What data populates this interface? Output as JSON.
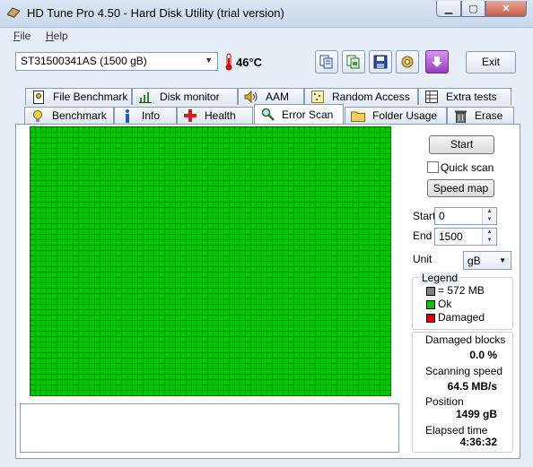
{
  "window": {
    "title": "HD Tune Pro 4.50 - Hard Disk Utility (trial version)"
  },
  "menu": {
    "file": "File",
    "help": "Help"
  },
  "toolbar": {
    "drive": "ST31500341AS (1500 gB)",
    "temperature": "46°C",
    "exit_label": "Exit"
  },
  "tabs_row1": [
    {
      "label": "File Benchmark",
      "icon": "file-icon"
    },
    {
      "label": "Disk monitor",
      "icon": "chart-icon"
    },
    {
      "label": "AAM",
      "icon": "speaker-icon"
    },
    {
      "label": "Random Access",
      "icon": "grid-icon"
    },
    {
      "label": "Extra tests",
      "icon": "table-icon"
    }
  ],
  "tabs_row2": [
    {
      "label": "Benchmark",
      "icon": "bulb-icon"
    },
    {
      "label": "Info",
      "icon": "info-icon"
    },
    {
      "label": "Health",
      "icon": "health-icon"
    },
    {
      "label": "Error Scan",
      "icon": "magnifier-icon",
      "active": true
    },
    {
      "label": "Folder Usage",
      "icon": "folder-icon"
    },
    {
      "label": "Erase",
      "icon": "trash-icon"
    }
  ],
  "controls": {
    "start_label": "Start",
    "quick_scan_label": "Quick scan",
    "quick_scan_checked": false,
    "speed_map_label": "Speed map",
    "start_field_label": "Start",
    "start_value": "0",
    "end_field_label": "End",
    "end_value": "1500",
    "unit_label": "Unit",
    "unit_value": "gB"
  },
  "legend": {
    "title": "Legend",
    "block_size": "= 572 MB",
    "ok": "Ok",
    "damaged": "Damaged",
    "colors": {
      "block": "#808080",
      "ok": "#00c800",
      "damaged": "#e00000"
    }
  },
  "stats": {
    "damaged_blocks_label": "Damaged blocks",
    "damaged_blocks_value": "0.0 %",
    "scanning_speed_label": "Scanning speed",
    "scanning_speed_value": "64.5 MB/s",
    "position_label": "Position",
    "position_value": "1499 gB",
    "elapsed_label": "Elapsed time",
    "elapsed_value": "4:36:32"
  },
  "scan_grid": {
    "status": "ok",
    "ok_color": "#00c800",
    "grid_color": "#1a5a1a"
  }
}
